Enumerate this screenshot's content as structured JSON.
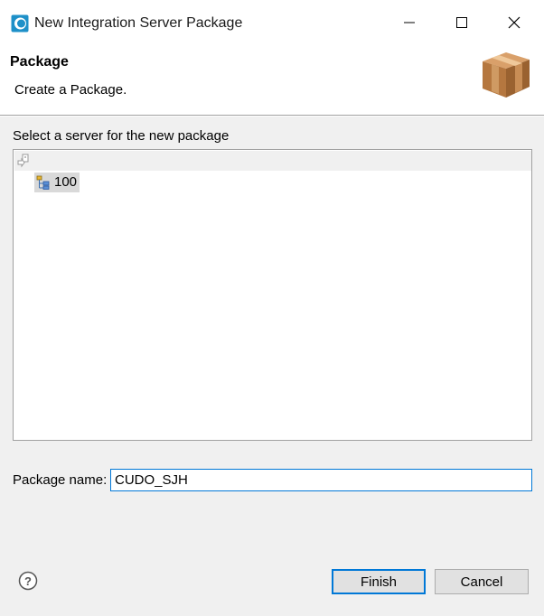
{
  "window": {
    "title": "New Integration Server Package"
  },
  "header": {
    "title": "Package",
    "description": "Create a Package."
  },
  "server_selection": {
    "label": "Select a server for the new package",
    "tree": {
      "child": {
        "label": "100",
        "selected": true
      }
    }
  },
  "package_name": {
    "label": "Package name:",
    "value": "CUDO_SJH"
  },
  "buttons": {
    "finish": "Finish",
    "cancel": "Cancel"
  },
  "colors": {
    "accent": "#0078d7",
    "dialog_background": "#f0f0f0",
    "package_brown": "#b5773f"
  },
  "icons": {
    "app": "eclipse-icon",
    "package": "package-box-icon",
    "root": "server-folder-icon",
    "child": "server-icon",
    "help": "help-icon"
  }
}
